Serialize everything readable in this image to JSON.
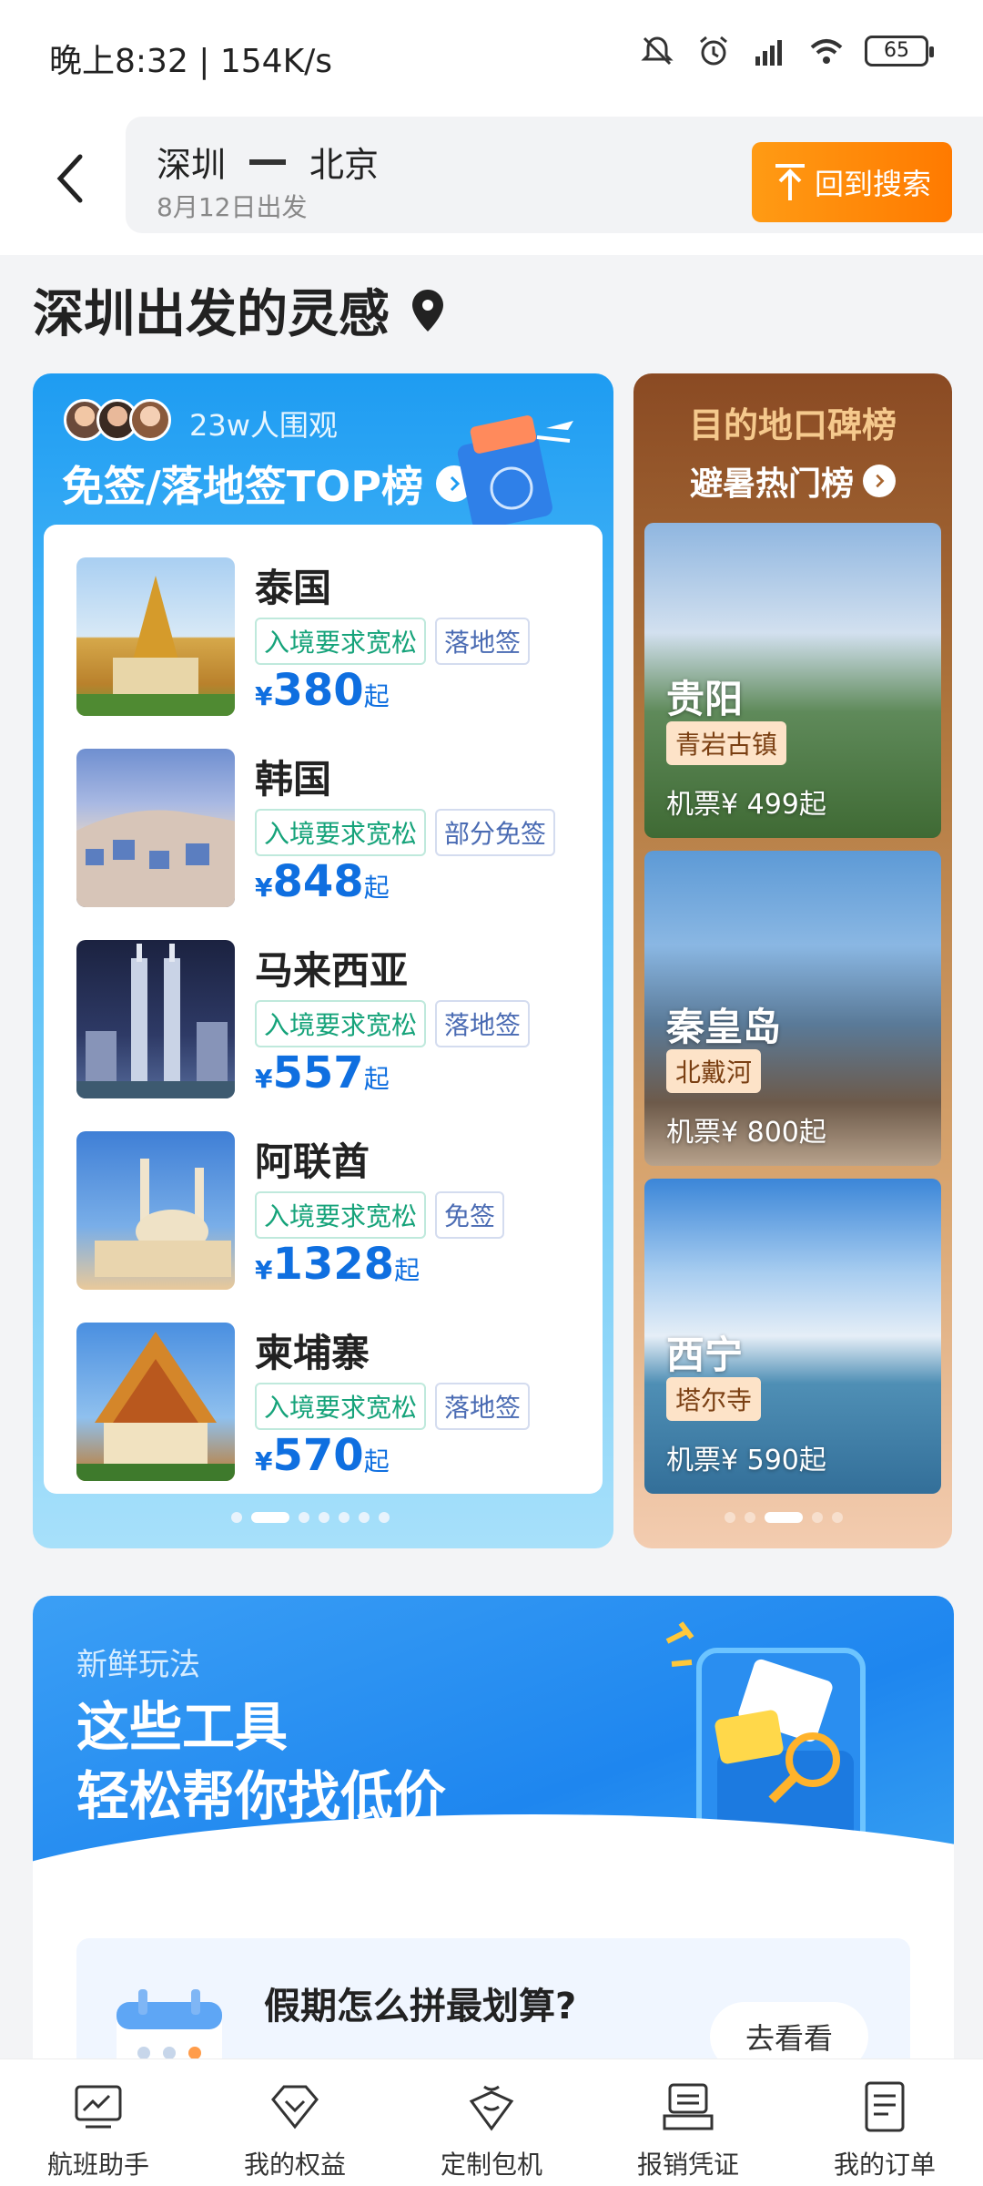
{
  "status_bar": {
    "time_speed": "晚上8:32 | 154K/s",
    "battery": "65"
  },
  "header": {
    "from": "深圳",
    "to": "北京",
    "date": "8月12日出发",
    "back_search": "回到搜索"
  },
  "section": {
    "title": "深圳出发的灵感"
  },
  "visa_card": {
    "watch_count": "23w人围观",
    "title": "免签/落地签TOP榜",
    "items": [
      {
        "name": "泰国",
        "tags": [
          "入境要求宽松",
          "落地签"
        ],
        "currency": "¥",
        "price": "380",
        "suffix": "起"
      },
      {
        "name": "韩国",
        "tags": [
          "入境要求宽松",
          "部分免签"
        ],
        "currency": "¥",
        "price": "848",
        "suffix": "起"
      },
      {
        "name": "马来西亚",
        "tags": [
          "入境要求宽松",
          "落地签"
        ],
        "currency": "¥",
        "price": "557",
        "suffix": "起"
      },
      {
        "name": "阿联酋",
        "tags": [
          "入境要求宽松",
          "免签"
        ],
        "currency": "¥",
        "price": "1328",
        "suffix": "起"
      },
      {
        "name": "柬埔寨",
        "tags": [
          "入境要求宽松",
          "落地签"
        ],
        "currency": "¥",
        "price": "570",
        "suffix": "起"
      }
    ]
  },
  "rank_card": {
    "title": "目的地口碑榜",
    "subtitle": "避暑热门榜",
    "cities": [
      {
        "name": "贵阳",
        "tag": "青岩古镇",
        "price": "机票¥ 499起"
      },
      {
        "name": "秦皇岛",
        "tag": "北戴河",
        "price": "机票¥ 800起"
      },
      {
        "name": "西宁",
        "tag": "塔尔寺",
        "price": "机票¥ 590起"
      }
    ]
  },
  "tools_card": {
    "eyebrow": "新鲜玩法",
    "headline_1": "这些工具",
    "headline_2": "轻松帮你找低价",
    "promo_title": "假期怎么拼最划算?",
    "promo_button": "去看看"
  },
  "bottom_nav": [
    {
      "label": "航班助手",
      "icon": "flight-assistant-icon"
    },
    {
      "label": "我的权益",
      "icon": "benefits-icon"
    },
    {
      "label": "定制包机",
      "icon": "charter-icon"
    },
    {
      "label": "报销凭证",
      "icon": "receipt-icon"
    },
    {
      "label": "我的订单",
      "icon": "orders-icon"
    }
  ]
}
